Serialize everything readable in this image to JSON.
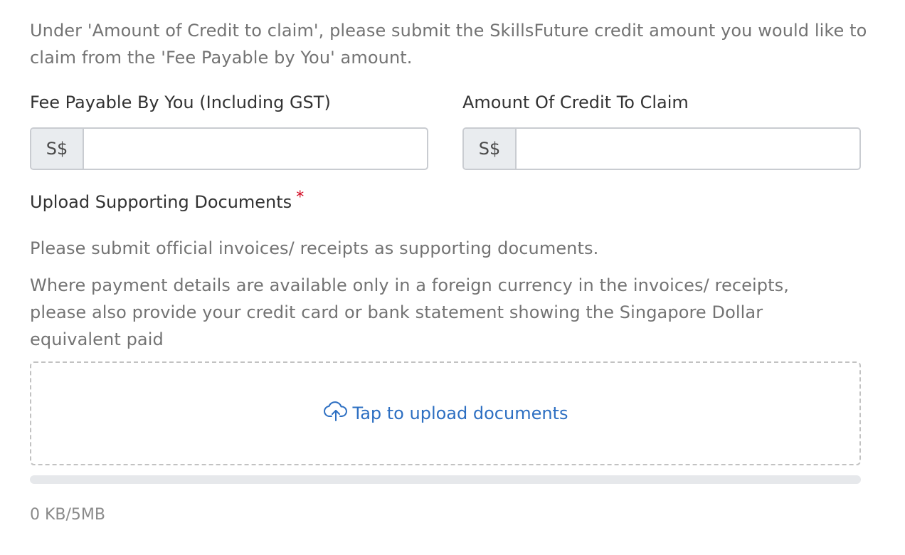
{
  "intro_text": "Under 'Amount of Credit to claim', please submit the SkillsFuture credit amount you would like to claim from the 'Fee Payable by You' amount.",
  "fee": {
    "label": "Fee Payable By You (Including GST)",
    "prefix": "S$",
    "value": "",
    "placeholder": ""
  },
  "credit": {
    "label": "Amount Of Credit To Claim",
    "prefix": "S$",
    "value": "",
    "placeholder": ""
  },
  "upload": {
    "label": "Upload Supporting Documents",
    "required_mark": "*",
    "help_1": "Please submit official invoices/ receipts as supporting documents.",
    "help_2": "Where payment details are available only in a foreign currency in the invoices/ receipts, please also provide your credit card or bank statement showing the Singapore Dollar equivalent paid",
    "dropzone_text": "Tap to upload documents",
    "dropzone_icon": "cloud-upload-icon",
    "progress_fraction": 0,
    "size_text": "0 KB/5MB"
  },
  "colors": {
    "accent": "#2d6fc2",
    "required": "#d0021b",
    "muted_text": "#737373",
    "prefix_bg": "#e9ecef"
  }
}
